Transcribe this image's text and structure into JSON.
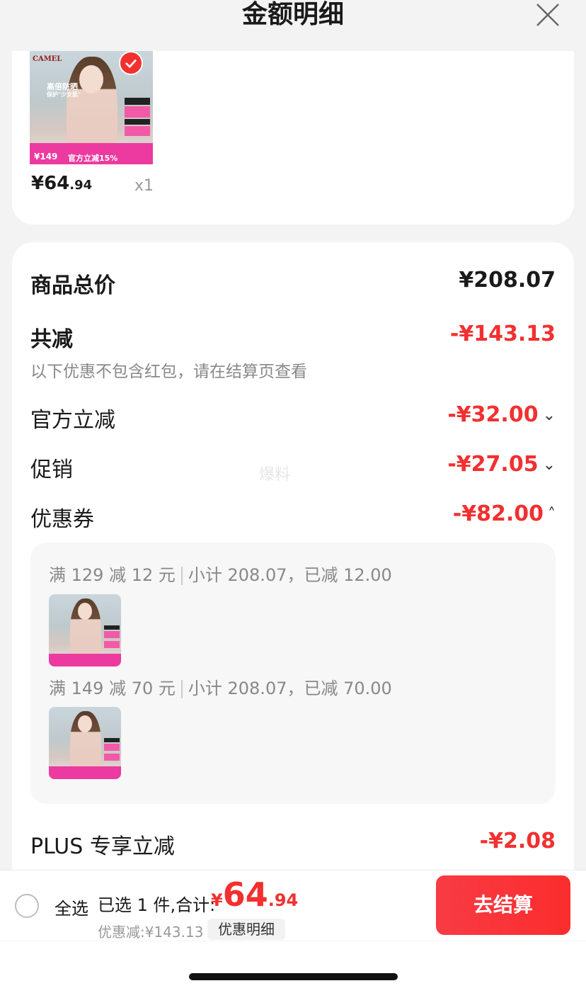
{
  "header": {
    "title": "金额明细"
  },
  "product": {
    "price_int": "¥64",
    "price_dec": ".94",
    "qty": "x1",
    "thumb": {
      "logo": "CAMEL",
      "headline": "高倍防晒",
      "tagline": "保护\"少女肌\"",
      "price_tag": "¥149",
      "promo": "官方立减15%"
    }
  },
  "summary": {
    "total_label": "商品总价",
    "total_value": "¥208.07",
    "reduce_label": "共减",
    "reduce_value": "-¥143.13",
    "reduce_note": "以下优惠不包含红包，请在结算页查看",
    "items": [
      {
        "label": "官方立减",
        "value": "-¥32.00",
        "chevron": "chevron-down-icon"
      },
      {
        "label": "促销",
        "value": "-¥27.05",
        "chevron": "chevron-down-icon"
      },
      {
        "label": "优惠券",
        "value": "-¥82.00",
        "chevron": "chevron-up-icon"
      }
    ],
    "coupons": [
      {
        "rule": "满 129 减 12 元",
        "detail": "小计 208.07，已减 12.00"
      },
      {
        "rule": "满 149 减 70 元",
        "detail": "小计 208.07，已减 70.00"
      }
    ],
    "plus_label": "PLUS 专享立减",
    "plus_value": "-¥2.08"
  },
  "watermark": "爆料",
  "footer": {
    "select_all": "全选",
    "selected_text": "已选 1 件,合计:",
    "total_cur": "¥",
    "total_int": "64",
    "total_dec": ".94",
    "discount_text": "优惠减:¥143.13",
    "detail_button": "优惠明细",
    "checkout_button": "去结算"
  },
  "colors": {
    "accent": "#f23030",
    "background": "#f3f3f3",
    "card": "#ffffff"
  }
}
